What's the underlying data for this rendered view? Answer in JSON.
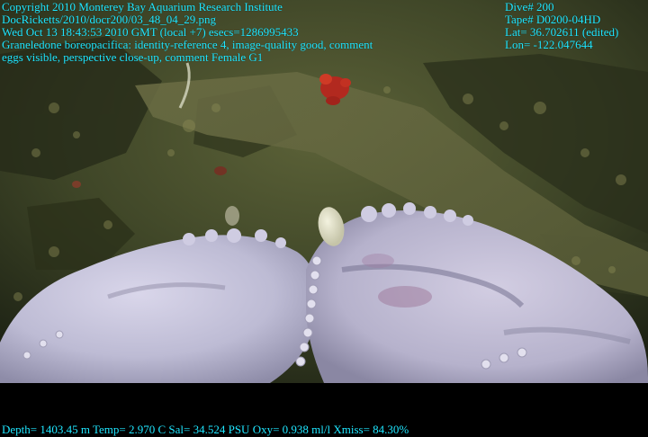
{
  "overlay": {
    "left": {
      "copyright": "Copyright 2010 Monterey Bay Aquarium Research Institute",
      "file_path": "DocRicketts/2010/docr200/03_48_04_29.png",
      "timestamp": "Wed Oct 13 18:43:53 2010 GMT (local +7)  esecs=1286995433",
      "annotation_line1": "Graneledone boreopacifica: identity-reference 4, image-quality good, comment",
      "annotation_line2": "eggs visible, perspective close-up, comment Female G1"
    },
    "right": {
      "dive": "Dive# 200",
      "tape": "Tape# D0200-04HD",
      "lat": "Lat= 36.702611 (edited)",
      "lon": "Lon= -122.047644"
    },
    "footer": {
      "telemetry": "Depth= 1403.45 m  Temp= 2.970 C  Sal= 34.524 PSU  Oxy= 0.938 ml/l  Xmiss= 84.30%"
    }
  },
  "colors": {
    "overlay_text": "#1fe6ff",
    "letterbox": "#000000",
    "seafloor": "#4a5230",
    "octopus": "#c9c8dc"
  }
}
